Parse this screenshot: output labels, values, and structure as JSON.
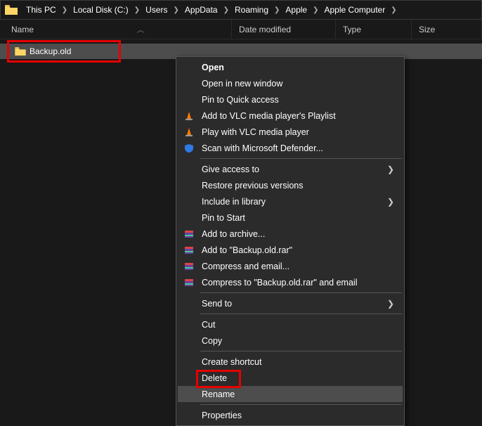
{
  "breadcrumb": {
    "items": [
      "This PC",
      "Local Disk (C:)",
      "Users",
      "AppData",
      "Roaming",
      "Apple",
      "Apple Computer"
    ]
  },
  "columns": {
    "name": "Name",
    "date": "Date modified",
    "type": "Type",
    "size": "Size"
  },
  "file": {
    "name": "Backup.old"
  },
  "menu": {
    "open": "Open",
    "open_new": "Open in new window",
    "pin_quick": "Pin to Quick access",
    "vlc_playlist": "Add to VLC media player's Playlist",
    "vlc_play": "Play with VLC media player",
    "defender": "Scan with Microsoft Defender...",
    "give_access": "Give access to",
    "restore": "Restore previous versions",
    "include_lib": "Include in library",
    "pin_start": "Pin to Start",
    "add_archive": "Add to archive...",
    "add_rar": "Add to \"Backup.old.rar\"",
    "compress_email": "Compress and email...",
    "compress_rar_email": "Compress to \"Backup.old.rar\" and email",
    "send_to": "Send to",
    "cut": "Cut",
    "copy": "Copy",
    "create_shortcut": "Create shortcut",
    "delete": "Delete",
    "rename": "Rename",
    "properties": "Properties"
  },
  "colors": {
    "highlight": "#e60000",
    "menu_bg": "#2b2b2b",
    "selection": "#4d4d4d"
  }
}
